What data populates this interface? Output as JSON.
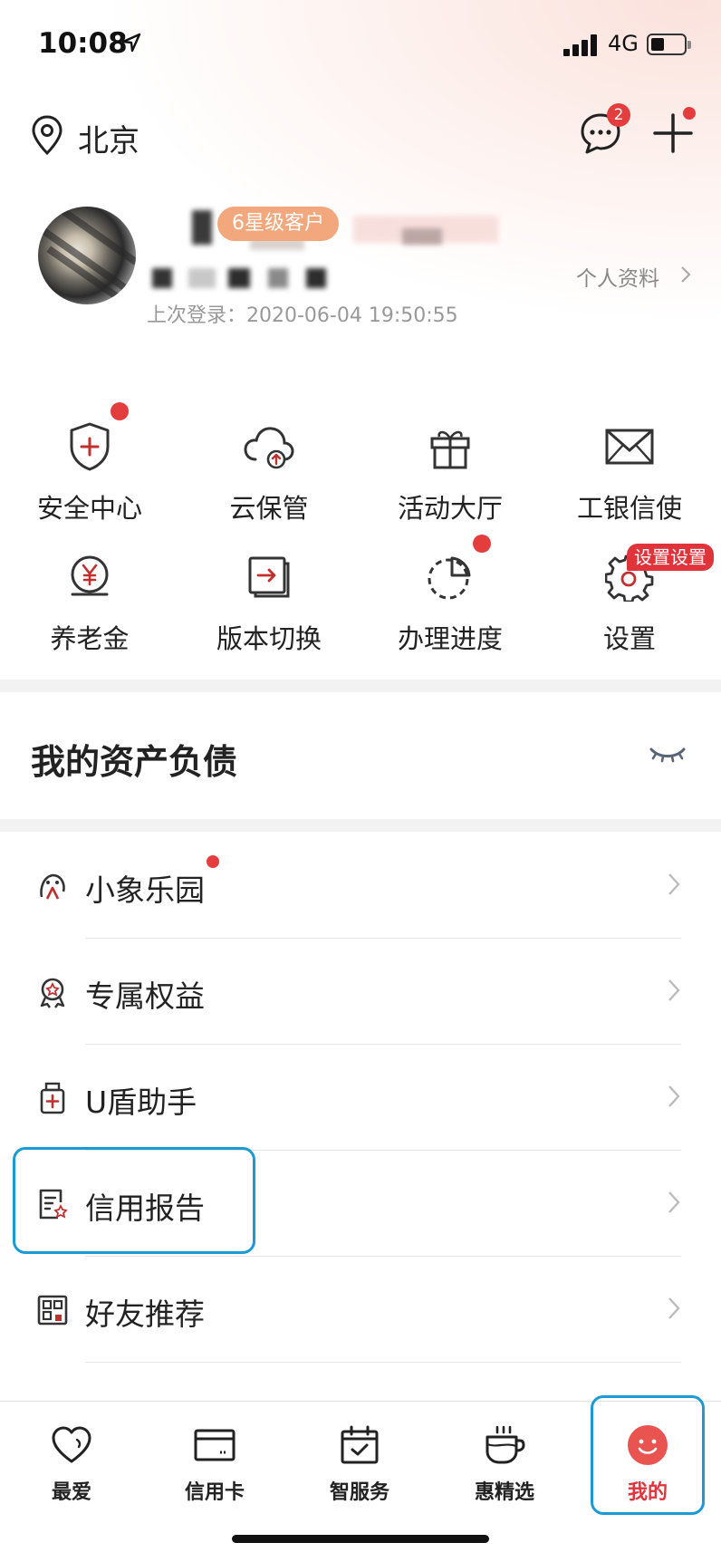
{
  "status_bar": {
    "time": "10:08",
    "network": "4G"
  },
  "header": {
    "city": "北京",
    "message_badge": "2"
  },
  "profile": {
    "tier_badge": "6星级客户",
    "last_login": "上次登录：2020-06-04 19:50:55",
    "profile_link": "个人资料"
  },
  "quick_grid": [
    {
      "label": "安全中心",
      "icon": "shield-plus-icon",
      "dot": true
    },
    {
      "label": "云保管",
      "icon": "cloud-upload-icon",
      "dot": false
    },
    {
      "label": "活动大厅",
      "icon": "gift-icon",
      "dot": false
    },
    {
      "label": "工银信使",
      "icon": "envelope-icon",
      "dot": false
    },
    {
      "label": "养老金",
      "icon": "yuan-coin-icon",
      "dot": false
    },
    {
      "label": "版本切换",
      "icon": "switch-icon",
      "dot": false
    },
    {
      "label": "办理进度",
      "icon": "progress-pie-icon",
      "dot": true
    },
    {
      "label": "设置",
      "icon": "gear-icon",
      "badge": "设置设置"
    }
  ],
  "assets": {
    "title": "我的资产负债",
    "icon": "eye-closed-icon"
  },
  "list": [
    {
      "label": "小象乐园",
      "icon": "elephant-icon",
      "dot": true
    },
    {
      "label": "专属权益",
      "icon": "medal-icon",
      "dot": false
    },
    {
      "label": "U盾助手",
      "icon": "usb-key-icon",
      "dot": false
    },
    {
      "label": "信用报告",
      "icon": "report-icon",
      "dot": false
    },
    {
      "label": "好友推荐",
      "icon": "qr-share-icon",
      "dot": false
    }
  ],
  "tabs": [
    {
      "label": "最爱",
      "icon": "heart-icon",
      "active": false
    },
    {
      "label": "信用卡",
      "icon": "credit-card-icon",
      "active": false
    },
    {
      "label": "智服务",
      "icon": "calendar-check-icon",
      "active": false
    },
    {
      "label": "惠精选",
      "icon": "cup-icon",
      "active": false
    },
    {
      "label": "我的",
      "icon": "smile-face-icon",
      "active": true
    }
  ],
  "colors": {
    "accent": "#e0343a",
    "highlight": "#1b9ad6",
    "badge_orange": "#f3a77c"
  }
}
